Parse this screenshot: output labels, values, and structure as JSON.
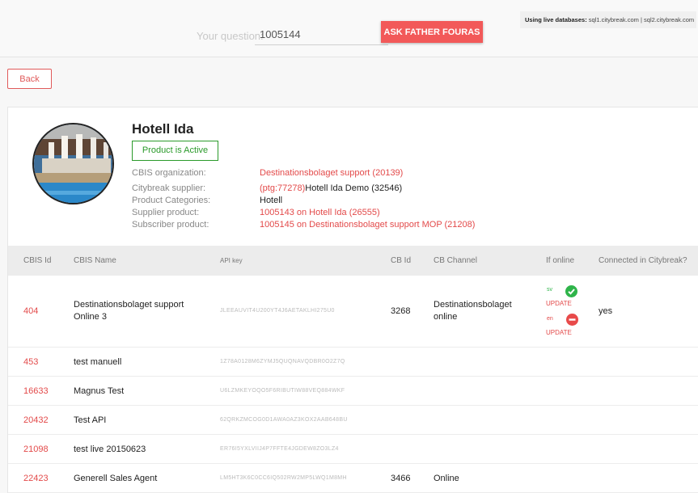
{
  "search": {
    "label": "Your question:",
    "value": "1005144",
    "button": "ASK FATHER FOURAS"
  },
  "live_db": {
    "label": "Using live databases:",
    "servers": "sql1.citybreak.com | sql2.citybreak.com"
  },
  "back_label": "Back",
  "product": {
    "name": "Hotell Ida",
    "status": "Product is Active",
    "info": [
      {
        "label": "CBIS organization:",
        "value": "Destinationsbolaget support (20139)"
      },
      {
        "label": "Citybreak supplier:",
        "prefix": "(ptg:77278)",
        "value": "Hotell Ida Demo (32546)"
      },
      {
        "label": "Product Categories:",
        "value": "Hotell"
      },
      {
        "label": "Supplier product:",
        "value": "1005143 on Hotell Ida (26555)"
      },
      {
        "label": "Subscriber product:",
        "value": "1005145 on Destinationsbolaget support MOP (21208)"
      }
    ]
  },
  "table": {
    "headers": [
      "CBIS Id",
      "CBIS Name",
      "API key",
      "CB Id",
      "CB Channel",
      "If online",
      "Connected in Citybreak?"
    ],
    "rows": [
      {
        "id": "404",
        "name1": "Destinationsbolaget support",
        "name2": "Online 3",
        "apikey": "JLEEAUVIT4U200YT4J6AETAKLHI275U0",
        "cbid": "3268",
        "channel1": "Destinationsbolaget",
        "channel2": "online",
        "lang_sv": "sv",
        "lang_en": "en",
        "update_sv": "UPDATE",
        "update_en": "UPDATE",
        "connected": "yes"
      },
      {
        "id": "453",
        "name": "test manuell",
        "apikey": "1Z78A0128M6ZYMJ5QUQNAVQDBR0O2Z7Q"
      },
      {
        "id": "16633",
        "name": "Magnus Test",
        "apikey": "U6LZMKEYOQO5F6RIBUTIW88VEQ884WKF"
      },
      {
        "id": "20432",
        "name": "Test API",
        "apikey": "62QRKZMCOG0D1AWA0AZ3KOX2AAB648BU"
      },
      {
        "id": "21098",
        "name": "test live 20150623",
        "apikey": "ER76I5YXLVIIJ4P7FFTE4JGDEW8ZO3LZ4"
      },
      {
        "id": "22423",
        "name": "Generell Sales Agent",
        "apikey": "LM5HT3K6C0CC6IQ502RW2MP5LWQ1M8MH",
        "cbid": "3466",
        "channel": "Online"
      }
    ]
  }
}
